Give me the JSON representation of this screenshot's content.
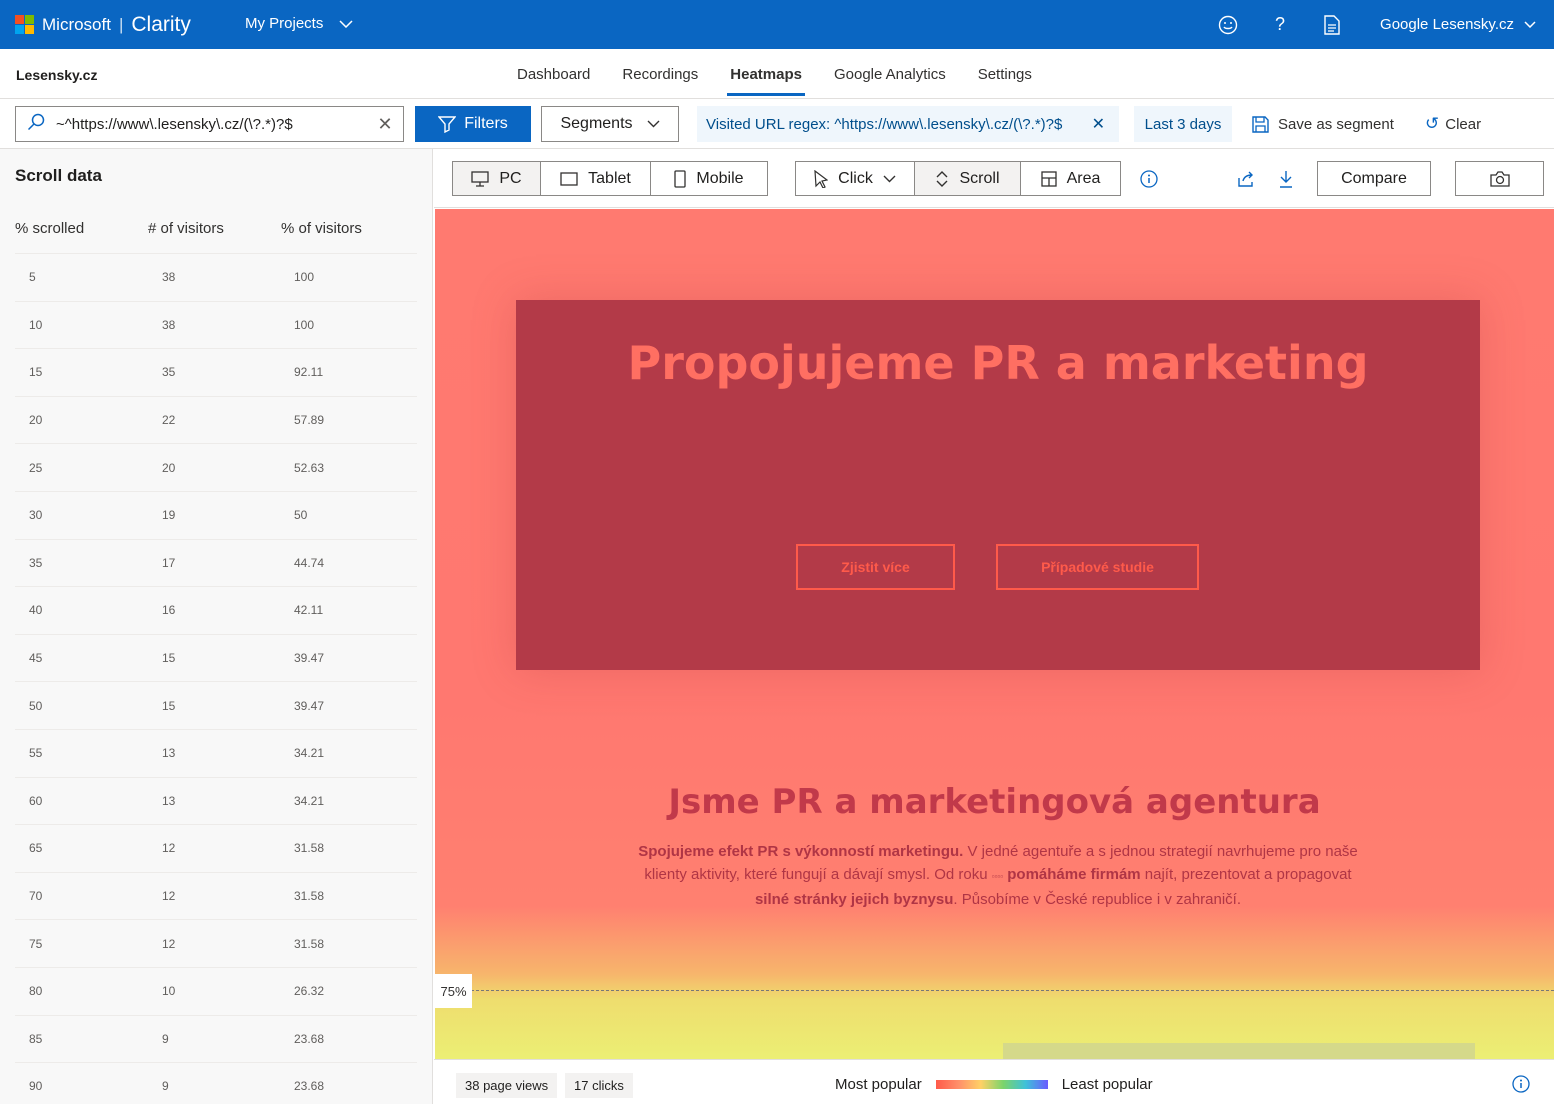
{
  "topbar": {
    "vendor": "Microsoft",
    "product": "Clarity",
    "projects_label": "My Projects",
    "account_label": "Google Lesensky.cz",
    "brand_color": "#0a66c2",
    "icons": [
      "smiley-icon",
      "help-icon",
      "document-icon"
    ]
  },
  "subbar": {
    "site_name": "Lesensky.cz",
    "tabs": [
      "Dashboard",
      "Recordings",
      "Heatmaps",
      "Google Analytics",
      "Settings"
    ],
    "active_tab": "Heatmaps"
  },
  "filterbar": {
    "search_value": "~^https://www\\.lesensky\\.cz/(\\?.*)?$",
    "filters_label": "Filters",
    "segments_label": "Segments",
    "url_chip": "Visited URL regex: ^https://www\\.lesensky\\.cz/(\\?.*)?$",
    "date_chip": "Last 3 days",
    "save_segment_label": "Save as segment",
    "clear_label": "Clear"
  },
  "sidebar": {
    "title": "Scroll data",
    "columns": [
      "% scrolled",
      "# of visitors",
      "% of visitors"
    ],
    "rows": [
      [
        "5",
        "38",
        "100"
      ],
      [
        "10",
        "38",
        "100"
      ],
      [
        "15",
        "35",
        "92.11"
      ],
      [
        "20",
        "22",
        "57.89"
      ],
      [
        "25",
        "20",
        "52.63"
      ],
      [
        "30",
        "19",
        "50"
      ],
      [
        "35",
        "17",
        "44.74"
      ],
      [
        "40",
        "16",
        "42.11"
      ],
      [
        "45",
        "15",
        "39.47"
      ],
      [
        "50",
        "15",
        "39.47"
      ],
      [
        "55",
        "13",
        "34.21"
      ],
      [
        "60",
        "13",
        "34.21"
      ],
      [
        "65",
        "12",
        "31.58"
      ],
      [
        "70",
        "12",
        "31.58"
      ],
      [
        "75",
        "12",
        "31.58"
      ],
      [
        "80",
        "10",
        "26.32"
      ],
      [
        "85",
        "9",
        "23.68"
      ],
      [
        "90",
        "9",
        "23.68"
      ]
    ]
  },
  "toolbar": {
    "devices": [
      "PC",
      "Tablet",
      "Mobile"
    ],
    "selected_device": "PC",
    "modes": [
      "Click",
      "Scroll",
      "Area"
    ],
    "selected_mode": "Scroll",
    "compare_label": "Compare"
  },
  "heatmap": {
    "hero_title": "Propojujeme PR a marketing",
    "hero_btn1": "Zjistit více",
    "hero_btn2": "Případové studie",
    "section_title": "Jsme PR a marketingová agentura",
    "section_text": {
      "b1": "Spojujeme efekt PR s výkonností marketingu.",
      "t1": " V jedné agentuře a s jednou strategií navrhujeme pro naše klienty aktivity, které fungují a dávají smysl. Od roku ",
      "year": "▫▫▫▫",
      "b2": " pomáháme firmám",
      "t2": " najít, prezentovat a propagovat ",
      "b3": "silné stránky jejich byznysu",
      "t3": ". Působíme v České republice i v zahraničí."
    },
    "fold_label": "75%"
  },
  "footer": {
    "page_views": "38 page views",
    "clicks": "17 clicks",
    "most_popular": "Most popular",
    "least_popular": "Least popular"
  }
}
